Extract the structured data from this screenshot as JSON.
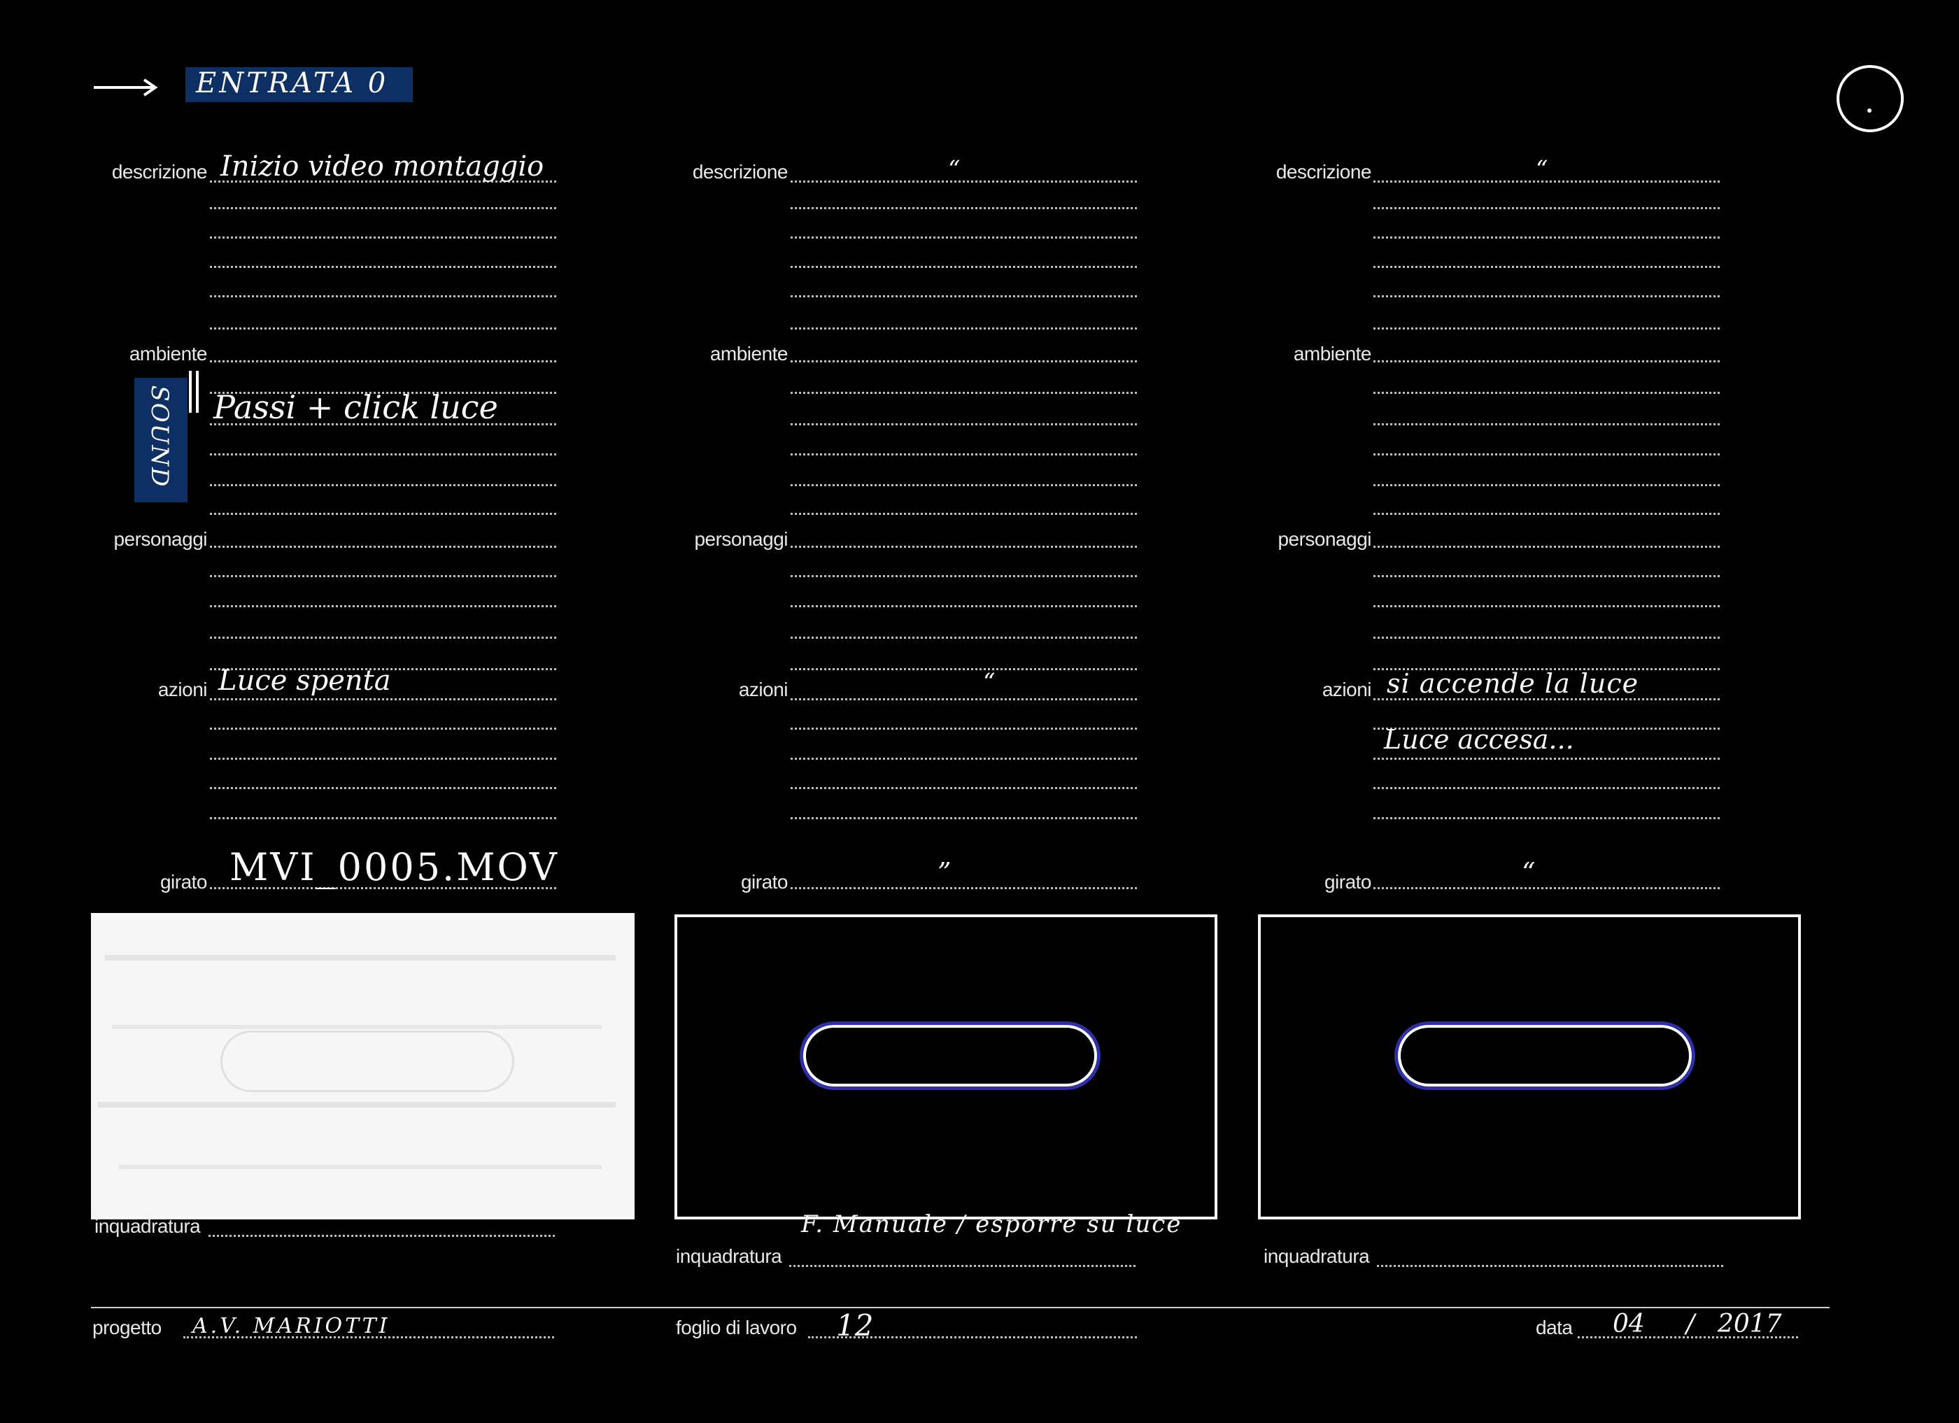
{
  "header": {
    "arrow": "arrow-right-icon",
    "entry_label": "ENTRATA",
    "entry_number": "0",
    "highlight_color": "#0e2f63"
  },
  "labels": {
    "descrizione": "descrizione",
    "ambiente": "ambiente",
    "personaggi": "personaggi",
    "azioni": "azioni",
    "girato": "girato",
    "inquadratura": "inquadratura"
  },
  "columns": [
    {
      "descrizione": "Inizio video montaggio",
      "ambiente": "",
      "ambiente_note": "Passi + click luce",
      "sound_tag": "SOUND",
      "azioni": "Luce spenta",
      "azioni_2": "",
      "girato": "MVI_0005.MOV",
      "frame_note": ""
    },
    {
      "descrizione": "“",
      "ambiente": "",
      "ambiente_note": "",
      "sound_tag": "",
      "azioni": "“",
      "azioni_2": "",
      "girato": "”",
      "frame_note": "F. Manuale / esporre su luce"
    },
    {
      "descrizione": "“",
      "ambiente": "",
      "ambiente_note": "",
      "sound_tag": "",
      "azioni": "si accende la luce",
      "azioni_2": "Luce accesa...",
      "girato": "“",
      "frame_note": ""
    }
  ],
  "footer": {
    "progetto_label": "progetto",
    "progetto_value": "A.V. MARIOTTI",
    "foglio_label": "foglio di lavoro",
    "foglio_value": "12",
    "data_label": "data",
    "data_value_month": "04",
    "data_sep": "/",
    "data_value_year": "2017"
  },
  "colors": {
    "background": "#000000",
    "ink": "#ffffff",
    "pill_glow": "#2f2fa8"
  }
}
